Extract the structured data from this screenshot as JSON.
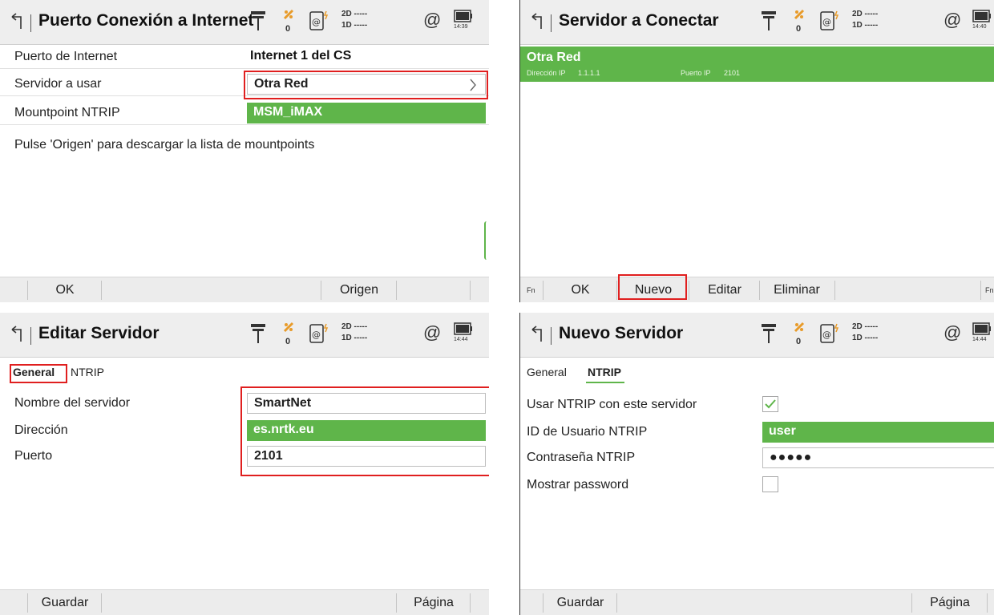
{
  "accent_green": "#5fb54a",
  "highlight_red": "#e01f1f",
  "status": {
    "sat_count": "0",
    "line_2d": "2D -----",
    "line_1d": "1D -----",
    "at_symbol": "@",
    "icons": [
      "antenna-icon",
      "satellite-icon",
      "internet-device-icon",
      "battery-icon"
    ]
  },
  "panel1": {
    "title": "Puerto Conexión a Internet",
    "time": "14:39",
    "rows": [
      {
        "label": "Puerto de Internet",
        "value": "Internet 1 del CS"
      },
      {
        "label": "Servidor a usar",
        "value": "Otra Red"
      },
      {
        "label": "Mountpoint NTRIP",
        "value": "MSM_iMAX"
      }
    ],
    "info": "Pulse 'Origen' para descargar la lista de mountpoints",
    "buttons": {
      "ok": "OK",
      "origen": "Origen"
    }
  },
  "panel2": {
    "title": "Servidor a Conectar",
    "time": "14:40",
    "item": {
      "name": "Otra Red",
      "ip_label": "Dirección IP",
      "ip_value": "1.1.1.1",
      "port_label": "Puerto IP",
      "port_value": "2101"
    },
    "buttons": {
      "fn": "Fn",
      "ok": "OK",
      "nuevo": "Nuevo",
      "editar": "Editar",
      "eliminar": "Eliminar",
      "fn_right": "Fn"
    }
  },
  "panel3": {
    "title": "Editar Servidor",
    "time": "14:44",
    "tabs": {
      "general": "General",
      "ntrip": "NTRIP"
    },
    "rows": [
      {
        "label": "Nombre del servidor",
        "value": "SmartNet"
      },
      {
        "label": "Dirección",
        "value": "es.nrtk.eu"
      },
      {
        "label": "Puerto",
        "value": "2101"
      }
    ],
    "buttons": {
      "guardar": "Guardar",
      "pagina": "Página"
    }
  },
  "panel4": {
    "title": "Nuevo Servidor",
    "time": "14:44",
    "tabs": {
      "general": "General",
      "ntrip": "NTRIP"
    },
    "rows": [
      {
        "label": "Usar NTRIP con este servidor",
        "checked": true
      },
      {
        "label": "ID de Usuario NTRIP",
        "value": "user"
      },
      {
        "label": "Contraseña NTRIP",
        "value": "●●●●●"
      },
      {
        "label": "Mostrar password",
        "checked": false
      }
    ],
    "buttons": {
      "guardar": "Guardar",
      "pagina": "Página"
    }
  }
}
